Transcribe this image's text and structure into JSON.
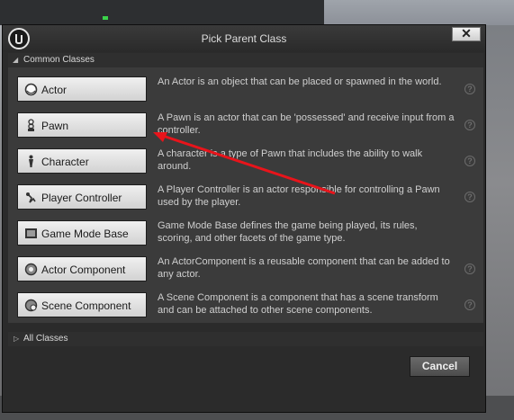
{
  "dialog": {
    "title": "Pick Parent Class",
    "close_glyph": "✕",
    "common_section": "Common Classes",
    "all_section": "All Classes",
    "cancel_label": "Cancel",
    "help_glyph": "?"
  },
  "classes": [
    {
      "label": "Actor",
      "icon": "actor-sphere-icon",
      "description": "An Actor is an object that can be placed or spawned in the world."
    },
    {
      "label": "Pawn",
      "icon": "pawn-icon",
      "description": "A Pawn is an actor that can be 'possessed' and receive input from a controller."
    },
    {
      "label": "Character",
      "icon": "character-icon",
      "description": "A character is a type of Pawn that includes the ability to walk around."
    },
    {
      "label": "Player Controller",
      "icon": "player-controller-icon",
      "description": "A Player Controller is an actor responsible for controlling a Pawn used by the player."
    },
    {
      "label": "Game Mode Base",
      "icon": "game-mode-icon",
      "description": "Game Mode Base defines the game being played, its rules, scoring, and other facets of the game type."
    },
    {
      "label": "Actor Component",
      "icon": "actor-component-icon",
      "description": "An ActorComponent is a reusable component that can be added to any actor."
    },
    {
      "label": "Scene Component",
      "icon": "scene-component-icon",
      "description": "A Scene Component is a component that has a scene transform and can be attached to other scene components."
    }
  ],
  "colors": {
    "annotation_arrow": "#e8141b",
    "dialog_bg": "#2b2b2b",
    "panel_bg": "#3b3b3b"
  }
}
